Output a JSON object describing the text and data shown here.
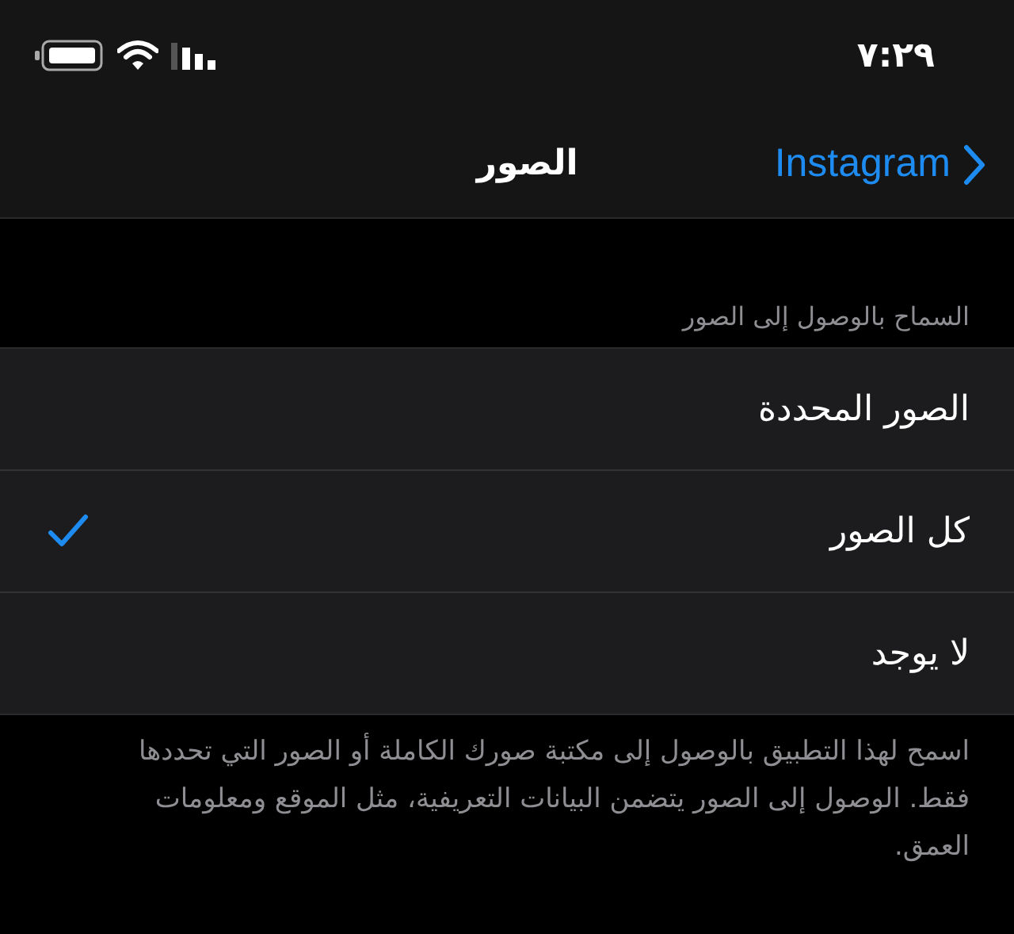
{
  "status_bar": {
    "time": "٧:٢٩"
  },
  "nav": {
    "back_label": "Instagram",
    "title": "الصور"
  },
  "section": {
    "header": "السماح بالوصول إلى الصور",
    "options": [
      {
        "label": "الصور المحددة",
        "selected": false
      },
      {
        "label": "كل الصور",
        "selected": true
      },
      {
        "label": "لا يوجد",
        "selected": false
      }
    ],
    "footer": "اسمح لهذا التطبيق بالوصول إلى مكتبة صورك الكاملة أو الصور التي تحددها فقط. الوصول إلى الصور يتضمن البيانات التعريفية، مثل الموقع ومعلومات العمق."
  }
}
